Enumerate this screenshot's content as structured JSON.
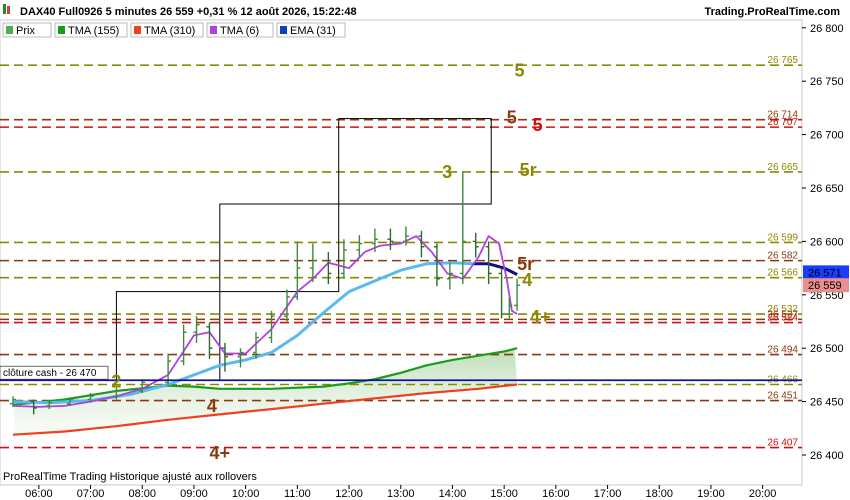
{
  "header": {
    "title": "DAX40 Full0926 5 minutes 26 559 +0,31 % 12 août 2026, 15:22:48",
    "site": "Trading.ProRealTime.com"
  },
  "legend": [
    {
      "label": "Prix",
      "color": "#4caf50"
    },
    {
      "label": "TMA (155)",
      "color": "#1a9c1a"
    },
    {
      "label": "TMA (310)",
      "color": "#f04020"
    },
    {
      "label": "TMA (6)",
      "color": "#b040e0"
    },
    {
      "label": "EMA (31)",
      "color": "#1040c0"
    }
  ],
  "footer": {
    "text": "ProRealTime Trading  Historique ajusté aux rollovers"
  },
  "cash_close": {
    "label": "clôture cash -  26 470",
    "value": 26470,
    "color": "#1010a0"
  },
  "price_badges": [
    {
      "text": "26 571",
      "value": 26571,
      "bg": "#1a3cff",
      "fg": "#ffffff"
    },
    {
      "text": "26 559",
      "value": 26559,
      "bg": "#e89090",
      "fg": "#000000"
    }
  ],
  "chart_data": {
    "type": "line",
    "title": "DAX40 Full0926 5 minutes",
    "ylim": [
      26383,
      26802
    ],
    "xlim": [
      5.5,
      20.35
    ],
    "y_ticks": [
      26400,
      26450,
      26500,
      26550,
      26600,
      26650,
      26700,
      26750,
      26800
    ],
    "y_tick_labels": [
      "26 400",
      "26 450",
      "26 500",
      "26 550",
      "26 600",
      "26 650",
      "26 700",
      "26 750",
      "26 800"
    ],
    "x_ticks": [
      6,
      7,
      8,
      9,
      10,
      11,
      12,
      13,
      14,
      15,
      16,
      17,
      18,
      19,
      20
    ],
    "x_tick_labels": [
      "06:00",
      "07:00",
      "08:00",
      "09:00",
      "10:00",
      "11:00",
      "12:00",
      "13:00",
      "14:00",
      "15:00",
      "16:00",
      "17:00",
      "18:00",
      "19:00",
      "20:00"
    ],
    "levels": [
      {
        "value": 26765,
        "label": "26 765",
        "color": "#8a8a00",
        "style": "dashed"
      },
      {
        "value": 26714,
        "label": "26 714",
        "color": "#8b3a10",
        "style": "dashed"
      },
      {
        "value": 26707,
        "label": "26 707",
        "color": "#d01010",
        "style": "dashed"
      },
      {
        "value": 26665,
        "label": "26 665",
        "color": "#8a8a00",
        "style": "dashed"
      },
      {
        "value": 26599,
        "label": "26 599",
        "color": "#8a8a00",
        "style": "dashed"
      },
      {
        "value": 26582,
        "label": "26 582",
        "color": "#8b3a10",
        "style": "dashed"
      },
      {
        "value": 26566,
        "label": "26 566",
        "color": "#8a8a00",
        "style": "dashed"
      },
      {
        "value": 26532,
        "label": "26 532",
        "color": "#8a8a00",
        "style": "dashed"
      },
      {
        "value": 26527,
        "label": "26 527",
        "color": "#8b3a10",
        "style": "dashed"
      },
      {
        "value": 26524,
        "label": "26 524",
        "color": "#d01010",
        "style": "dashed"
      },
      {
        "value": 26494,
        "label": "26 494",
        "color": "#8b3a10",
        "style": "dashed"
      },
      {
        "value": 26466,
        "label": "26 466",
        "color": "#8a8a00",
        "style": "dashed"
      },
      {
        "value": 26451,
        "label": "26 451",
        "color": "#8b3a10",
        "style": "dashed"
      },
      {
        "value": 26407,
        "label": "26 407",
        "color": "#d01010",
        "style": "dashed"
      }
    ],
    "level_markers": [
      {
        "text": "5",
        "x": 15.2,
        "y": 26760,
        "color": "#8a8a00"
      },
      {
        "text": "5",
        "x": 15.05,
        "y": 26716,
        "color": "#8b3a10"
      },
      {
        "text": "5",
        "x": 15.55,
        "y": 26709,
        "color": "#d01010"
      },
      {
        "text": "5r",
        "x": 15.3,
        "y": 26667,
        "color": "#8a8a00"
      },
      {
        "text": "5r",
        "x": 15.25,
        "y": 26579,
        "color": "#8b3a10"
      },
      {
        "text": "4",
        "x": 15.35,
        "y": 26564,
        "color": "#8a8a00"
      },
      {
        "text": "4+",
        "x": 15.5,
        "y": 26529,
        "color": "#8a8a00"
      },
      {
        "text": "3",
        "x": 13.8,
        "y": 26665,
        "color": "#8a8a00"
      },
      {
        "text": "2",
        "x": 7.4,
        "y": 26469,
        "color": "#8a8a00"
      },
      {
        "text": "4",
        "x": 9.25,
        "y": 26446,
        "color": "#8b3a10"
      },
      {
        "text": "4+",
        "x": 9.3,
        "y": 26402,
        "color": "#8b3a10"
      }
    ],
    "boxes": [
      {
        "x0": 7.5,
        "x1": 9.5,
        "y0": 26470,
        "y1": 26553
      },
      {
        "x0": 9.5,
        "x1": 11.8,
        "y0": 26553,
        "y1": 26635
      },
      {
        "x0": 11.8,
        "x1": 14.75,
        "y0": 26635,
        "y1": 26715
      }
    ],
    "series": [
      {
        "name": "TMA (310)",
        "color": "#f04020",
        "x": [
          5.5,
          6.5,
          7.5,
          8.5,
          9.5,
          10.5,
          11.5,
          12.5,
          13.5,
          14.5,
          15.25
        ],
        "y": [
          26419,
          26422,
          26427,
          26433,
          26438,
          26443,
          26448,
          26453,
          26458,
          26462,
          26466
        ]
      },
      {
        "name": "TMA (155)",
        "color": "#1a9c1a",
        "x": [
          5.5,
          6.5,
          7.5,
          8.5,
          9.0,
          9.5,
          10.5,
          11.5,
          12.0,
          12.5,
          13.0,
          13.5,
          14.0,
          14.5,
          15.0,
          15.25
        ],
        "y": [
          26447,
          26452,
          26460,
          26465,
          26464,
          26462,
          26462,
          26464,
          26467,
          26471,
          26477,
          26484,
          26489,
          26493,
          26497,
          26500
        ]
      },
      {
        "name": "EMA (31)",
        "color": "#5abaf0",
        "x": [
          5.5,
          6.2,
          7.0,
          7.8,
          8.5,
          9.0,
          9.5,
          10.0,
          10.5,
          11.0,
          11.5,
          12.0,
          12.5,
          13.0,
          13.5,
          14.0,
          14.4
        ],
        "y": [
          26450,
          26449,
          26451,
          26457,
          26466,
          26475,
          26484,
          26489,
          26496,
          26512,
          26533,
          26553,
          26563,
          26573,
          26579,
          26580,
          26579
        ]
      },
      {
        "name": "EMA (31)",
        "color": "#101080",
        "x": [
          14.4,
          14.7,
          15.0,
          15.25
        ],
        "y": [
          26579,
          26579,
          26575,
          26569
        ]
      },
      {
        "name": "TMA (6)",
        "color": "#b040e0",
        "x": [
          5.5,
          6.0,
          6.5,
          7.0,
          7.5,
          8.0,
          8.5,
          9.0,
          9.3,
          9.6,
          10.0,
          10.5,
          11.0,
          11.3,
          11.6,
          12.0,
          12.3,
          12.6,
          13.0,
          13.3,
          13.6,
          13.9,
          14.2,
          14.5,
          14.7,
          14.9,
          15.05,
          15.15,
          15.25
        ],
        "y": [
          26446,
          26445,
          26446,
          26450,
          26455,
          26462,
          26475,
          26512,
          26515,
          26495,
          26495,
          26518,
          26553,
          26565,
          26580,
          26575,
          26590,
          26596,
          26598,
          26605,
          26590,
          26570,
          26565,
          26585,
          26605,
          26598,
          26565,
          26535,
          26532
        ]
      }
    ],
    "price": [
      {
        "x": 5.5,
        "o": 26448,
        "c": 26452,
        "h": 26455,
        "l": 26445
      },
      {
        "x": 5.9,
        "o": 26450,
        "c": 26444,
        "h": 26452,
        "l": 26438
      },
      {
        "x": 6.2,
        "o": 26446,
        "c": 26449,
        "h": 26451,
        "l": 26443
      },
      {
        "x": 6.6,
        "o": 26448,
        "c": 26452,
        "h": 26454,
        "l": 26446
      },
      {
        "x": 7.0,
        "o": 26452,
        "c": 26455,
        "h": 26458,
        "l": 26449
      },
      {
        "x": 7.5,
        "o": 26455,
        "c": 26460,
        "h": 26463,
        "l": 26452
      },
      {
        "x": 8.0,
        "o": 26460,
        "c": 26468,
        "h": 26471,
        "l": 26458
      },
      {
        "x": 8.5,
        "o": 26468,
        "c": 26488,
        "h": 26495,
        "l": 26465
      },
      {
        "x": 8.8,
        "o": 26488,
        "c": 26515,
        "h": 26522,
        "l": 26484
      },
      {
        "x": 9.05,
        "o": 26515,
        "c": 26522,
        "h": 26530,
        "l": 26505
      },
      {
        "x": 9.3,
        "o": 26520,
        "c": 26500,
        "h": 26524,
        "l": 26490
      },
      {
        "x": 9.6,
        "o": 26500,
        "c": 26492,
        "h": 26505,
        "l": 26478
      },
      {
        "x": 9.9,
        "o": 26492,
        "c": 26496,
        "h": 26500,
        "l": 26482
      },
      {
        "x": 10.2,
        "o": 26496,
        "c": 26510,
        "h": 26515,
        "l": 26490
      },
      {
        "x": 10.5,
        "o": 26510,
        "c": 26530,
        "h": 26535,
        "l": 26505
      },
      {
        "x": 10.8,
        "o": 26530,
        "c": 26548,
        "h": 26555,
        "l": 26525
      },
      {
        "x": 11.0,
        "o": 26548,
        "c": 26575,
        "h": 26600,
        "l": 26545
      },
      {
        "x": 11.3,
        "o": 26575,
        "c": 26582,
        "h": 26598,
        "l": 26562
      },
      {
        "x": 11.6,
        "o": 26582,
        "c": 26570,
        "h": 26590,
        "l": 26560
      },
      {
        "x": 11.9,
        "o": 26570,
        "c": 26592,
        "h": 26602,
        "l": 26565
      },
      {
        "x": 12.2,
        "o": 26592,
        "c": 26598,
        "h": 26606,
        "l": 26585
      },
      {
        "x": 12.5,
        "o": 26598,
        "c": 26602,
        "h": 26612,
        "l": 26590
      },
      {
        "x": 12.8,
        "o": 26602,
        "c": 26600,
        "h": 26612,
        "l": 26592
      },
      {
        "x": 13.1,
        "o": 26600,
        "c": 26605,
        "h": 26614,
        "l": 26596
      },
      {
        "x": 13.4,
        "o": 26605,
        "c": 26595,
        "h": 26610,
        "l": 26585
      },
      {
        "x": 13.7,
        "o": 26595,
        "c": 26565,
        "h": 26598,
        "l": 26558
      },
      {
        "x": 13.95,
        "o": 26565,
        "c": 26570,
        "h": 26580,
        "l": 26555
      },
      {
        "x": 14.2,
        "o": 26570,
        "c": 26600,
        "h": 26665,
        "l": 26560
      },
      {
        "x": 14.45,
        "o": 26600,
        "c": 26595,
        "h": 26608,
        "l": 26585
      },
      {
        "x": 14.7,
        "o": 26595,
        "c": 26570,
        "h": 26600,
        "l": 26560
      },
      {
        "x": 14.95,
        "o": 26570,
        "c": 26532,
        "h": 26575,
        "l": 26528
      },
      {
        "x": 15.1,
        "o": 26532,
        "c": 26540,
        "h": 26548,
        "l": 26528
      },
      {
        "x": 15.25,
        "o": 26540,
        "c": 26559,
        "h": 26565,
        "l": 26535
      }
    ]
  }
}
